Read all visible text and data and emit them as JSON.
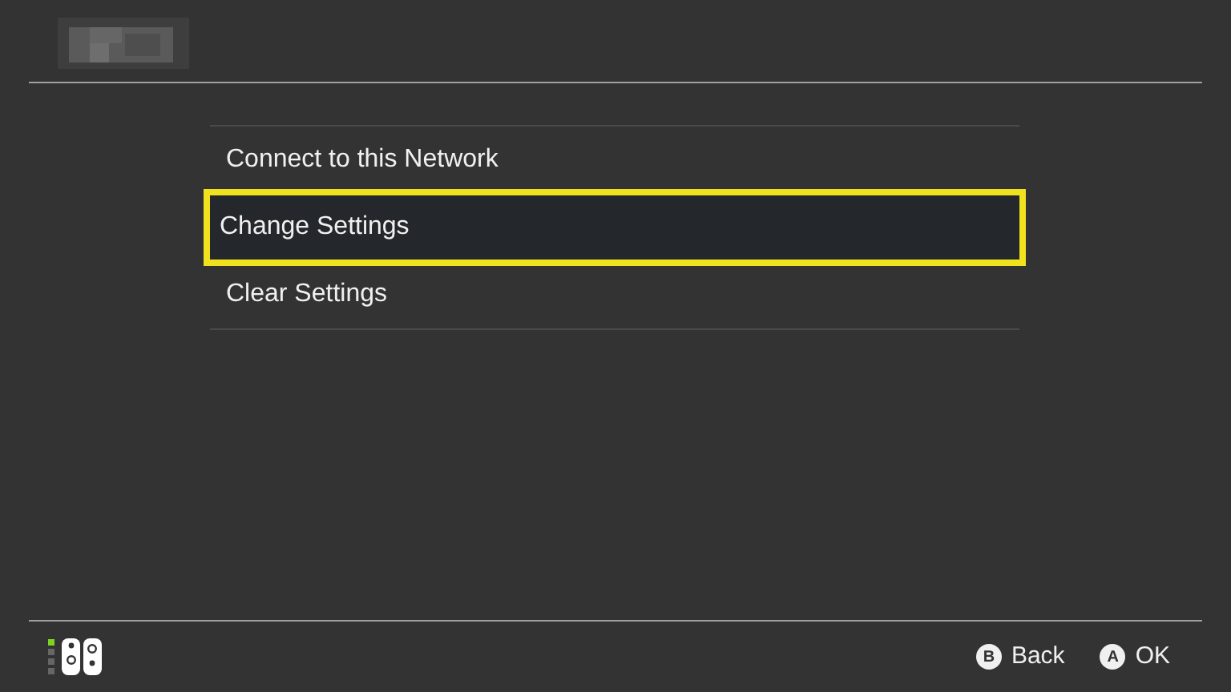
{
  "header": {
    "title_redacted": true
  },
  "menu": {
    "items": [
      {
        "label": "Connect to this Network",
        "selected": false
      },
      {
        "label": "Change Settings",
        "selected": true
      },
      {
        "label": "Clear Settings",
        "selected": false
      }
    ]
  },
  "footer": {
    "player_lights": [
      {
        "on": true
      },
      {
        "on": false
      },
      {
        "on": false
      },
      {
        "on": false
      }
    ],
    "buttons": [
      {
        "key": "B",
        "label": "Back"
      },
      {
        "key": "A",
        "label": "OK"
      }
    ]
  }
}
